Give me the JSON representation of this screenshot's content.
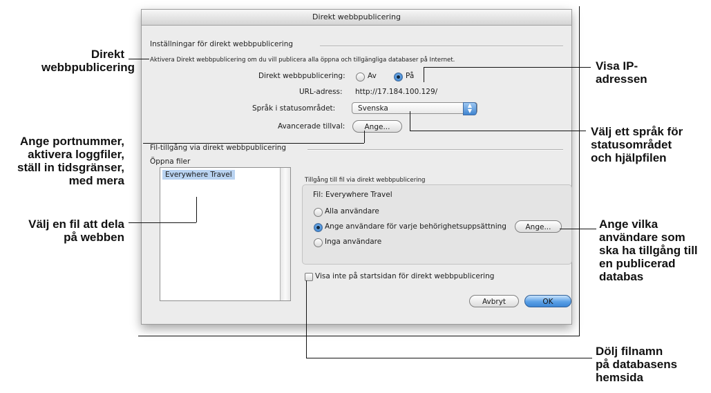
{
  "dialog": {
    "title": "Direkt webbpublicering",
    "section1_title": "Inställningar för direkt webbpublicering",
    "description": "Aktivera Direkt webbpublicering om du vill publicera alla öppna och tillgängliga databaser på Internet.",
    "publish_label": "Direkt webbpublicering:",
    "radio_off": "Av",
    "radio_on": "På",
    "publish_selected": "På",
    "url_label": "URL-adress:",
    "url_value": "http://17.184.100.129/",
    "language_label": "Språk i statusområdet:",
    "language_value": "Svenska",
    "advanced_label": "Avancerade tillval:",
    "advanced_button": "Ange...",
    "section2_title": "Fil-tillgång via direkt webbpublicering",
    "open_files_label": "Öppna filer",
    "open_files": [
      "Everywhere Travel"
    ],
    "access_group_title": "Tillgång till fil via direkt webbpublicering",
    "file_label": "Fil: Everywhere Travel",
    "access_options": [
      "Alla användare",
      "Ange användare för varje behörighetsuppsättning",
      "Inga användare"
    ],
    "access_selected": "Ange användare för varje behörighetsuppsättning",
    "specify_button": "Ange...",
    "hide_checkbox_label": "Visa inte på startsidan för direkt webbpublicering",
    "hide_checked": false,
    "cancel_button": "Avbryt",
    "ok_button": "OK"
  },
  "callouts": {
    "direct_publishing": "Direkt\nwebbpublicering",
    "port_number": "Ange portnummer,\naktivera loggfiler,\nställ in tidsgränser,\nmed mera",
    "choose_file": "Välj en fil att dela\npå webben",
    "show_ip": "Visa IP-\nadressen",
    "choose_language": "Välj ett språk för\nstatusområdet\noch hjälpfilen",
    "specify_users": "Ange vilka\nanvändare som\nska ha tillgång till\nen publicerad\ndatabas",
    "hide_filenames": "Dölj filnamn\npå databasens\nhemsida"
  },
  "colors": {
    "default_button": "#3d86d5",
    "selection": "#b9d3f1",
    "window_bg": "#ececec"
  }
}
